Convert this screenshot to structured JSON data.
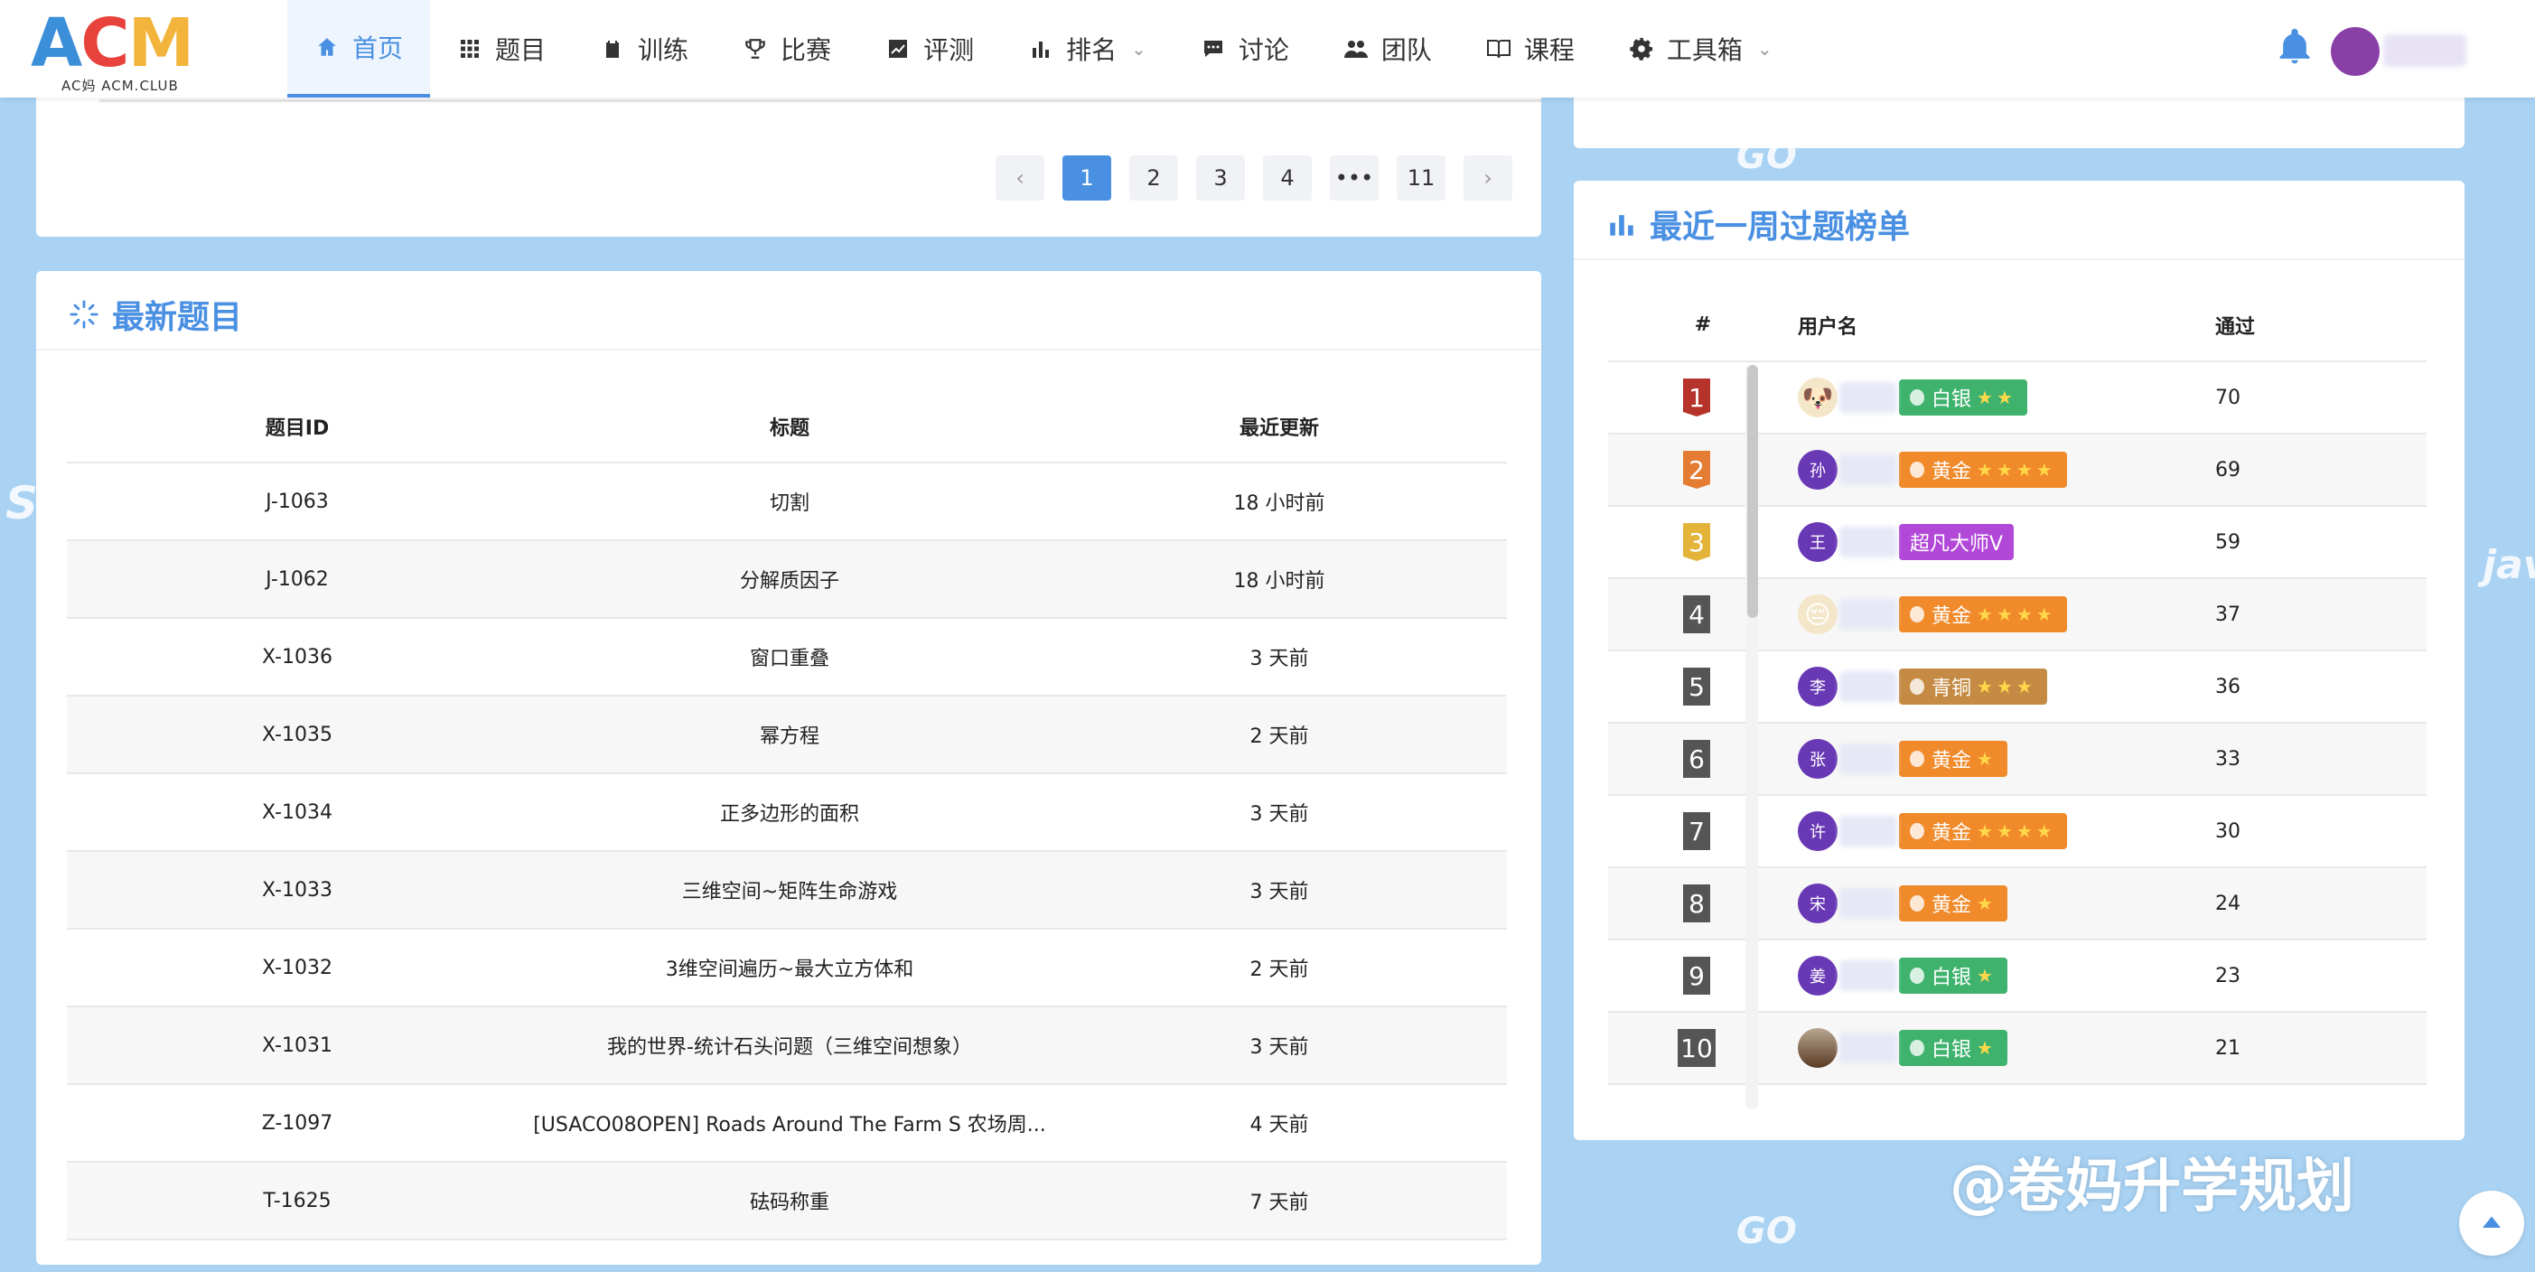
{
  "logo": {
    "text": "ACM",
    "sub": "ACM.CLUB",
    "sub_prefix": "AC妈"
  },
  "nav": {
    "items": [
      {
        "label": "首页",
        "icon": "home-icon",
        "active": true
      },
      {
        "label": "题目",
        "icon": "grid-icon"
      },
      {
        "label": "训练",
        "icon": "clipboard-icon"
      },
      {
        "label": "比赛",
        "icon": "trophy-icon"
      },
      {
        "label": "评测",
        "icon": "trend-icon"
      },
      {
        "label": "排名",
        "icon": "bar-chart-icon",
        "dropdown": true
      },
      {
        "label": "讨论",
        "icon": "chat-icon"
      },
      {
        "label": "团队",
        "icon": "team-icon"
      },
      {
        "label": "课程",
        "icon": "book-icon"
      },
      {
        "label": "工具箱",
        "icon": "gear-icon",
        "dropdown": true
      }
    ]
  },
  "pager": {
    "pages": [
      "1",
      "2",
      "3",
      "4",
      "•••",
      "11"
    ],
    "prev": "‹",
    "next": "›",
    "active": "1"
  },
  "latest": {
    "title": "最新题目",
    "headers": [
      "题目ID",
      "标题",
      "最近更新"
    ],
    "rows": [
      [
        "J-1063",
        "切割",
        "18 小时前"
      ],
      [
        "J-1062",
        "分解质因子",
        "18 小时前"
      ],
      [
        "X-1036",
        "窗口重叠",
        "3 天前"
      ],
      [
        "X-1035",
        "幂方程",
        "2 天前"
      ],
      [
        "X-1034",
        "正多边形的面积",
        "3 天前"
      ],
      [
        "X-1033",
        "三维空间~矩阵生命游戏",
        "3 天前"
      ],
      [
        "X-1032",
        "3维空间遍历~最大立方体和",
        "2 天前"
      ],
      [
        "X-1031",
        "我的世界-统计石头问题（三维空间想象）",
        "3 天前"
      ],
      [
        "Z-1097",
        "[USACO08OPEN] Roads Around The Farm S 农场周...",
        "4 天前"
      ],
      [
        "T-1625",
        "砝码称重",
        "7 天前"
      ]
    ]
  },
  "weekly": {
    "title": "最近一周过题榜单",
    "headers": [
      "#",
      "用户名",
      "通过"
    ],
    "rows": [
      {
        "rank": "1",
        "avatar": "🐶",
        "badge": "白银",
        "badge_type": "silver",
        "stars": "★★",
        "passed": "70"
      },
      {
        "rank": "2",
        "avatar": "孙",
        "badge": "黄金",
        "badge_type": "gold",
        "stars": "★★★★",
        "passed": "69"
      },
      {
        "rank": "3",
        "avatar": "王",
        "badge": "超凡大师Ⅴ",
        "badge_type": "master",
        "stars": "",
        "passed": "59"
      },
      {
        "rank": "4",
        "avatar": "😔",
        "badge": "黄金",
        "badge_type": "gold",
        "stars": "★★★★",
        "passed": "37"
      },
      {
        "rank": "5",
        "avatar": "李",
        "badge": "青铜",
        "badge_type": "bronze",
        "stars": "★★★",
        "passed": "36"
      },
      {
        "rank": "6",
        "avatar": "张",
        "badge": "黄金",
        "badge_type": "gold",
        "stars": "★",
        "passed": "33"
      },
      {
        "rank": "7",
        "avatar": "许",
        "badge": "黄金",
        "badge_type": "gold",
        "stars": "★★★★",
        "passed": "30"
      },
      {
        "rank": "8",
        "avatar": "宋",
        "badge": "黄金",
        "badge_type": "gold",
        "stars": "★",
        "passed": "24"
      },
      {
        "rank": "9",
        "avatar": "姜",
        "badge": "白银",
        "badge_type": "silver",
        "stars": "★",
        "passed": "23"
      },
      {
        "rank": "10",
        "avatar": "",
        "badge": "白银",
        "badge_type": "silver",
        "stars": "★",
        "passed": "21"
      }
    ]
  },
  "watermark": "@卷妈升学规划",
  "colors": {
    "accent": "#4a90e2",
    "silver": "#3fb36e",
    "gold": "#f08a2a",
    "master": "#b148d8",
    "bronze": "#c58b44"
  }
}
